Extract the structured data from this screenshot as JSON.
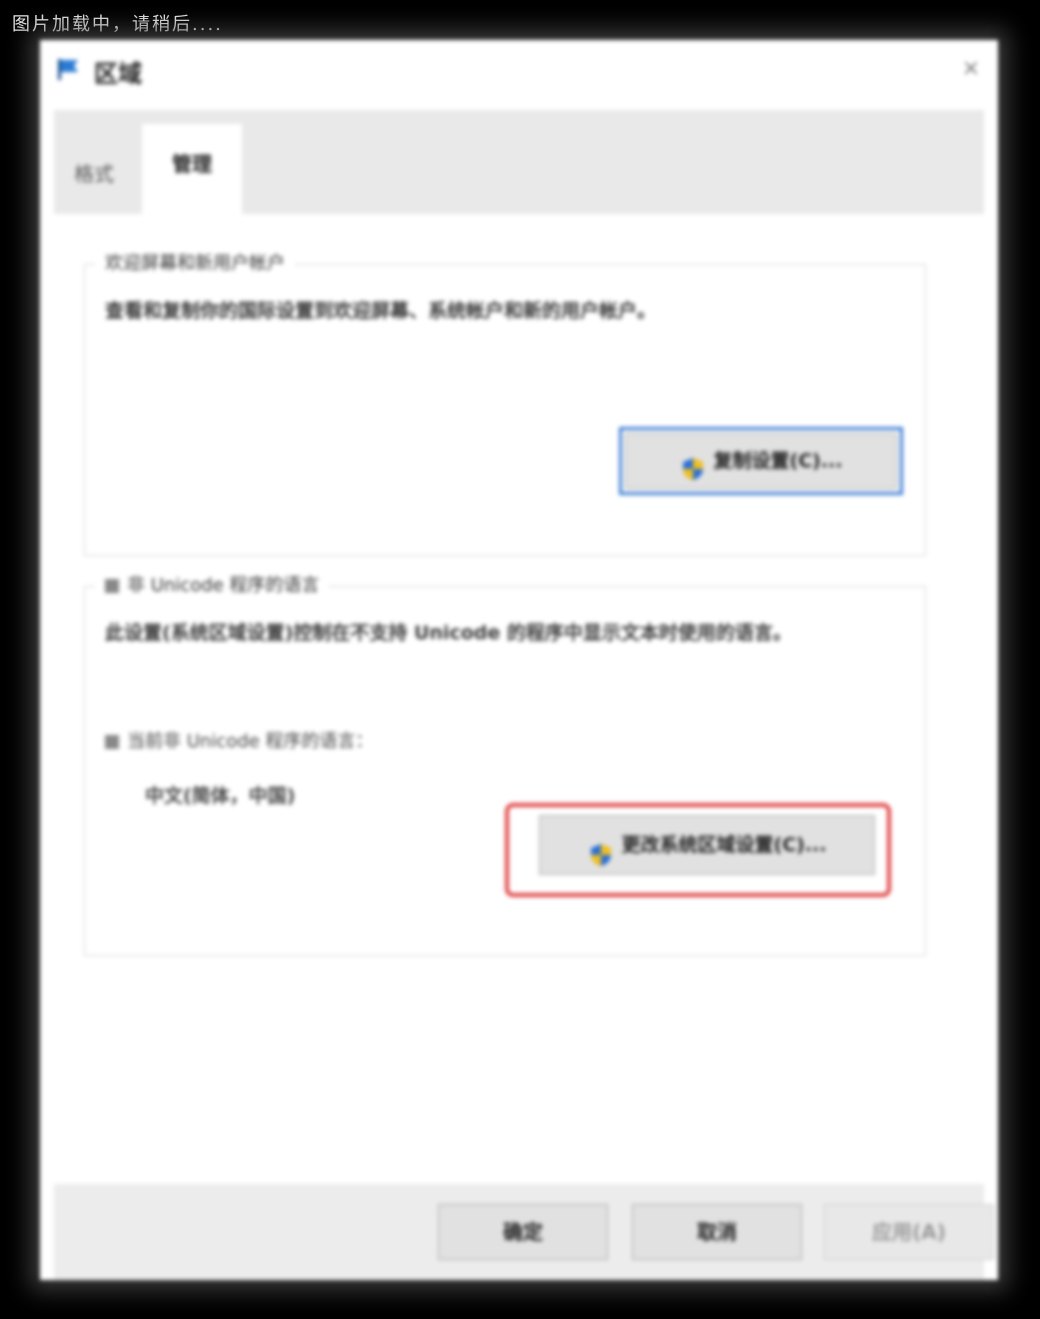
{
  "loading_banner": "图片加载中，请稍后....",
  "dialog": {
    "title": "区域",
    "close_glyph": "×"
  },
  "tabs": [
    {
      "label": "格式"
    },
    {
      "label": "管理"
    }
  ],
  "welcome_group": {
    "legend": "欢迎屏幕和新用户帐户",
    "description": "查看和复制你的国际设置到欢迎屏幕、系统帐户和新的用户帐户。",
    "button_label": "复制设置(C)..."
  },
  "unicode_group": {
    "legend": "非 Unicode 程序的语言",
    "description": "此设置(系统区域设置)控制在不支持 Unicode 的程序中显示文本时使用的语言。",
    "current_label": "当前非 Unicode 程序的语言：",
    "current_value": "中文(简体，中国)",
    "button_label": "更改系统区域设置(C)..."
  },
  "footer": {
    "ok": "确定",
    "cancel": "取消",
    "apply": "应用(A)"
  },
  "colors": {
    "highlight": "#e04545",
    "focus": "#3a7bd5"
  }
}
